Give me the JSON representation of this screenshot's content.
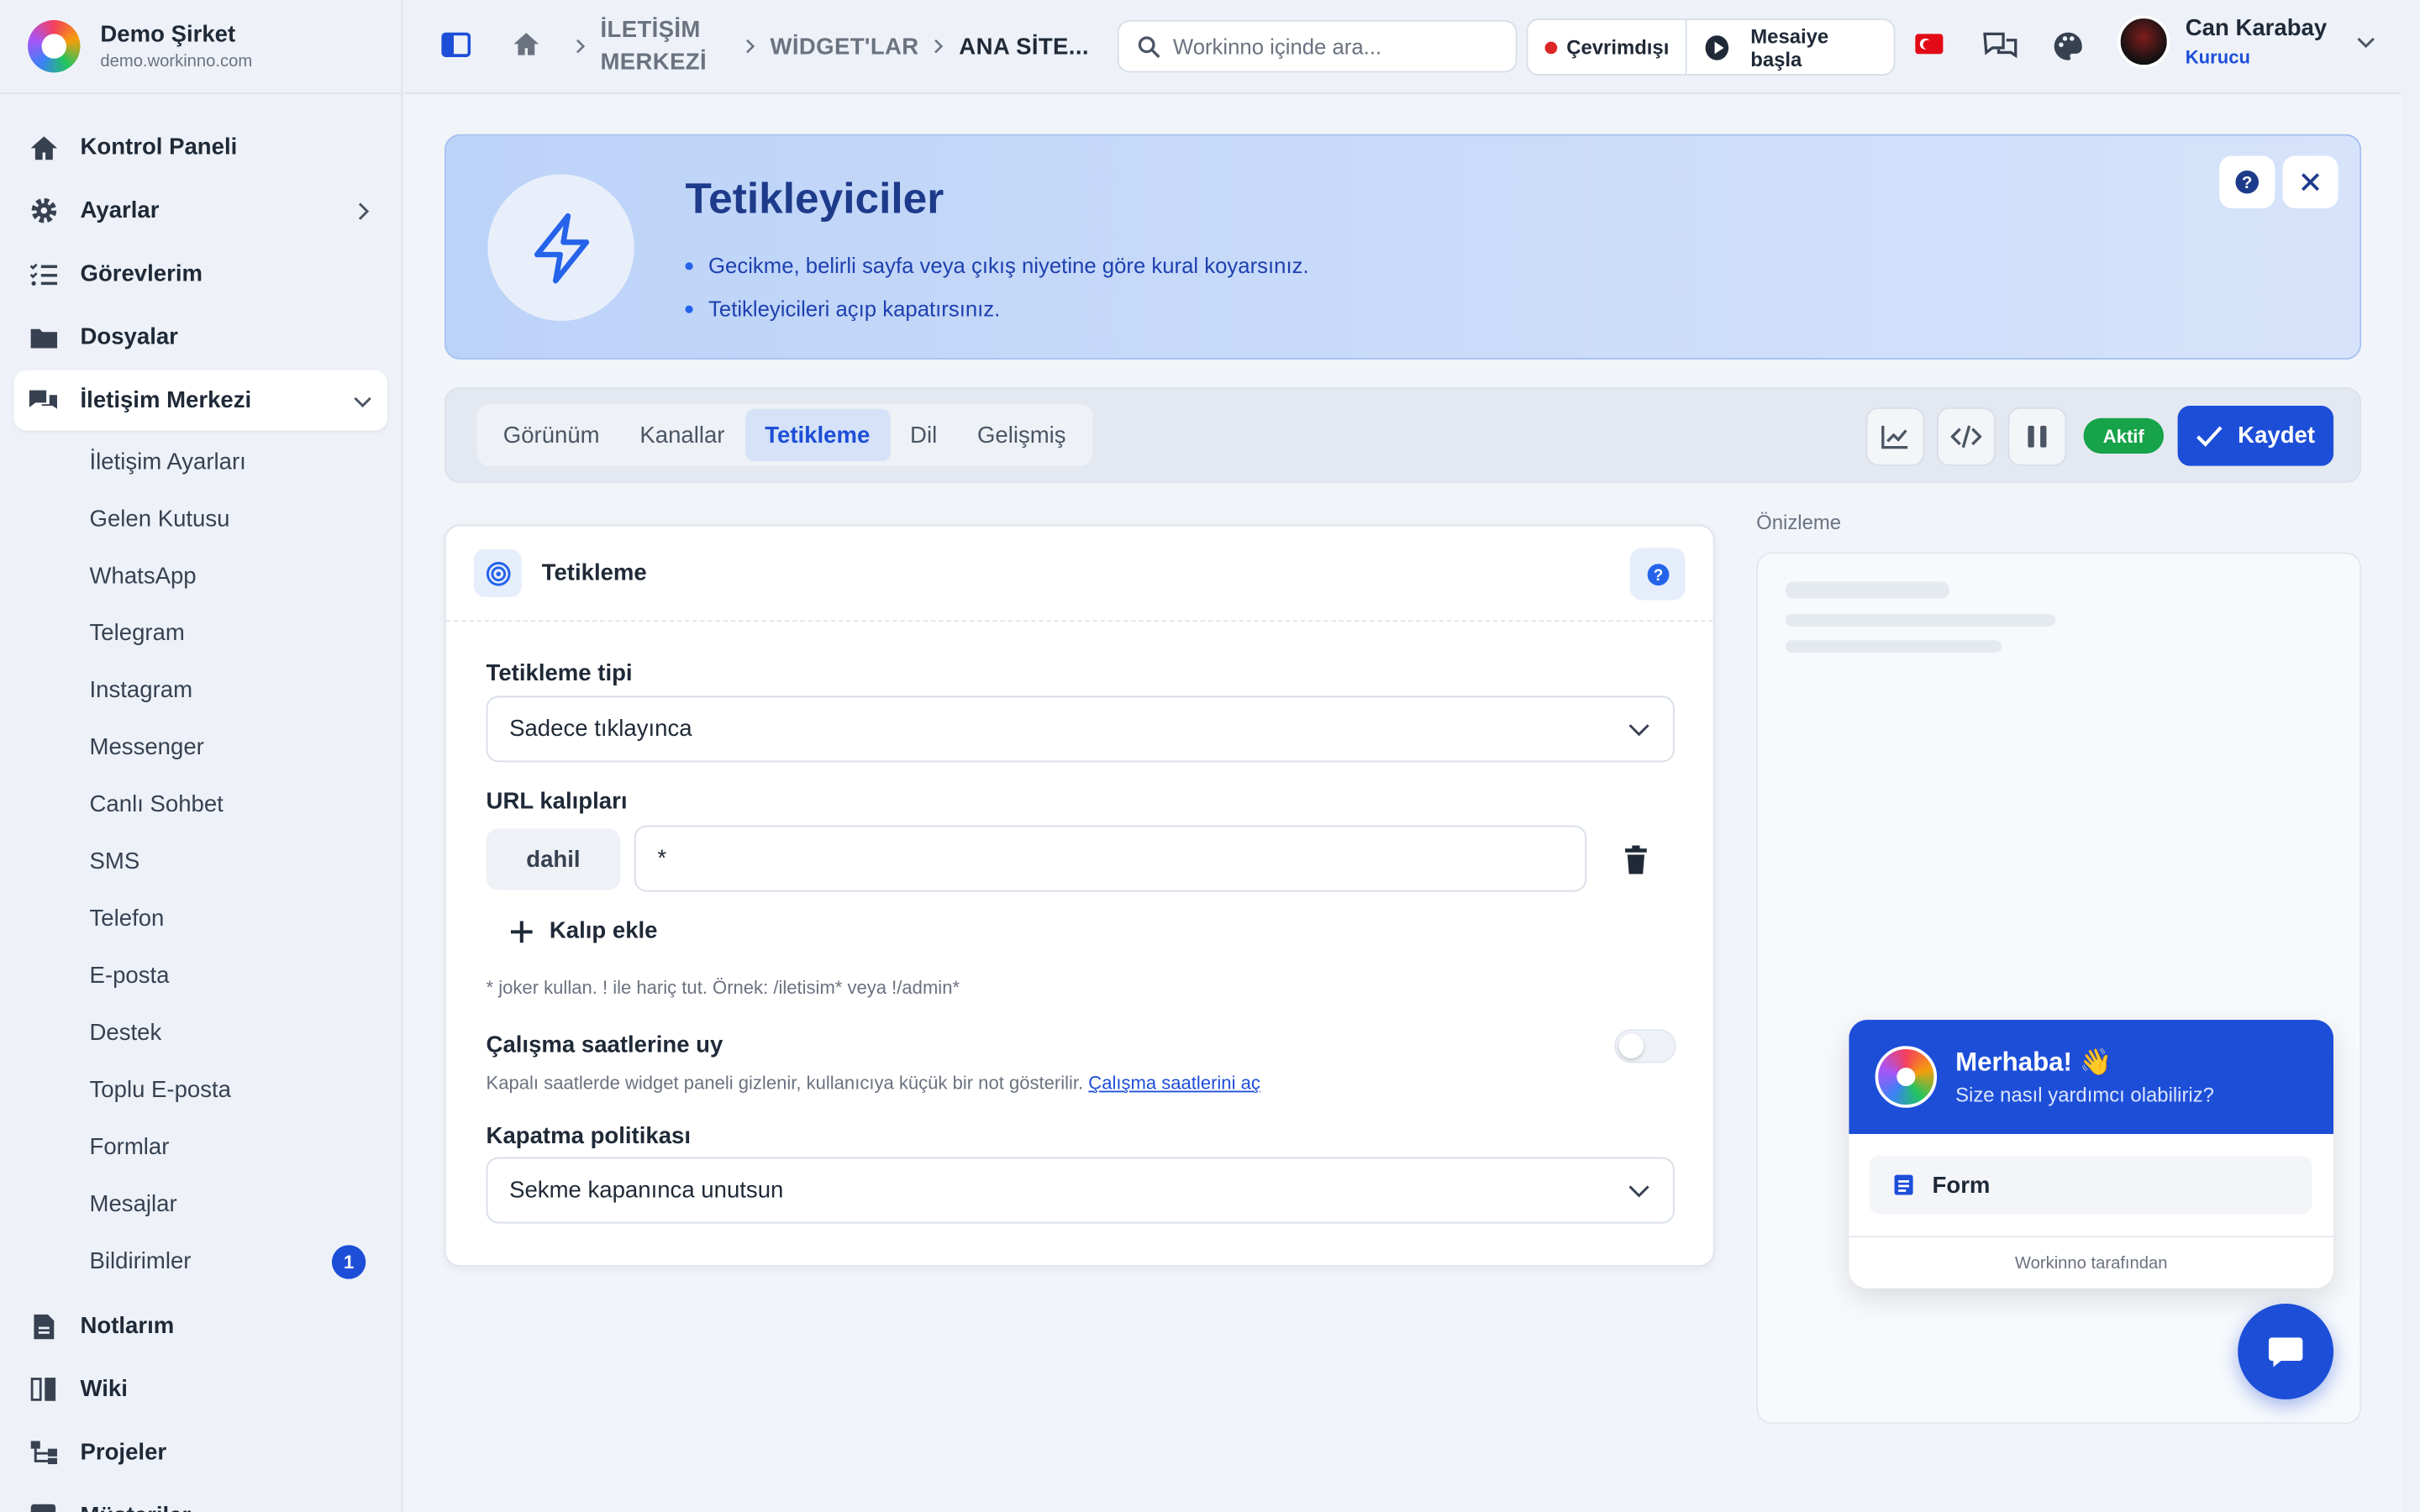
{
  "company": {
    "name": "Demo Şirket",
    "domain": "demo.workinno.com"
  },
  "sidebar": {
    "main_items": [
      {
        "label": "Kontrol Paneli",
        "icon": "home-icon"
      },
      {
        "label": "Ayarlar",
        "icon": "gear-icon"
      },
      {
        "label": "Görevlerim",
        "icon": "tasks-icon"
      },
      {
        "label": "Dosyalar",
        "icon": "folder-icon"
      },
      {
        "label": "İletişim Merkezi",
        "icon": "chat-icon"
      }
    ],
    "sub_items": [
      "İletişim Ayarları",
      "Gelen Kutusu",
      "WhatsApp",
      "Telegram",
      "Instagram",
      "Messenger",
      "Canlı Sohbet",
      "SMS",
      "Telefon",
      "E-posta",
      "Destek",
      "Toplu E-posta",
      "Formlar",
      "Mesajlar",
      "Bildirimler"
    ],
    "notification_badge": "1",
    "bottom_items": [
      {
        "label": "Notlarım",
        "icon": "note-icon"
      },
      {
        "label": "Wiki",
        "icon": "book-icon"
      },
      {
        "label": "Projeler",
        "icon": "projects-icon"
      },
      {
        "label": "Müşteriler",
        "icon": "customers-icon"
      }
    ]
  },
  "breadcrumb": {
    "item1": "İLETİŞİM MERKEZİ",
    "item2": "WİDGET'LAR",
    "item3": "ANA SİTE..."
  },
  "search": {
    "placeholder": "Workinno içinde ara..."
  },
  "status": {
    "offline": "Çevrimdışı",
    "start_shift": "Mesaiye başla"
  },
  "user": {
    "name": "Can Karabay",
    "role": "Kurucu"
  },
  "hero": {
    "title": "Tetikleyiciler",
    "bullets": [
      "Gecikme, belirli sayfa veya çıkış niyetine göre kural koyarsınız.",
      "Tetikleyicileri açıp kapatırsınız."
    ]
  },
  "tabs": [
    "Görünüm",
    "Kanallar",
    "Tetikleme",
    "Dil",
    "Gelişmiş"
  ],
  "active_tab": "Tetikleme",
  "toolbar": {
    "status_badge": "Aktif",
    "save_label": "Kaydet"
  },
  "trigger_card": {
    "title": "Tetikleme",
    "trigger_type_label": "Tetikleme tipi",
    "trigger_type_value": "Sadece tıklayınca",
    "url_patterns_label": "URL kalıpları",
    "pattern_mode": "dahil",
    "pattern_value": "*",
    "add_pattern_label": "Kalıp ekle",
    "pattern_hint": "* joker kullan. ! ile hariç tut. Örnek: /iletisim* veya !/admin*",
    "working_hours_label": "Çalışma saatlerine uy",
    "working_hours_hint": "Kapalı saatlerde widget paneli gizlenir, kullanıcıya küçük bir not gösterilir.",
    "working_hours_link": "Çalışma saatlerini aç",
    "working_hours_enabled": false,
    "close_policy_label": "Kapatma politikası",
    "close_policy_value": "Sekme kapanınca unutsun"
  },
  "preview": {
    "label": "Önizleme",
    "greeting": "Merhaba! 👋",
    "subtitle": "Size nasıl yardımcı olabiliriz?",
    "form_item": "Form",
    "powered_by": "Workinno tarafından"
  },
  "colors": {
    "accent": "#1d4ed8",
    "active_badge": "#16a34a",
    "offline_dot": "#dc2626"
  }
}
